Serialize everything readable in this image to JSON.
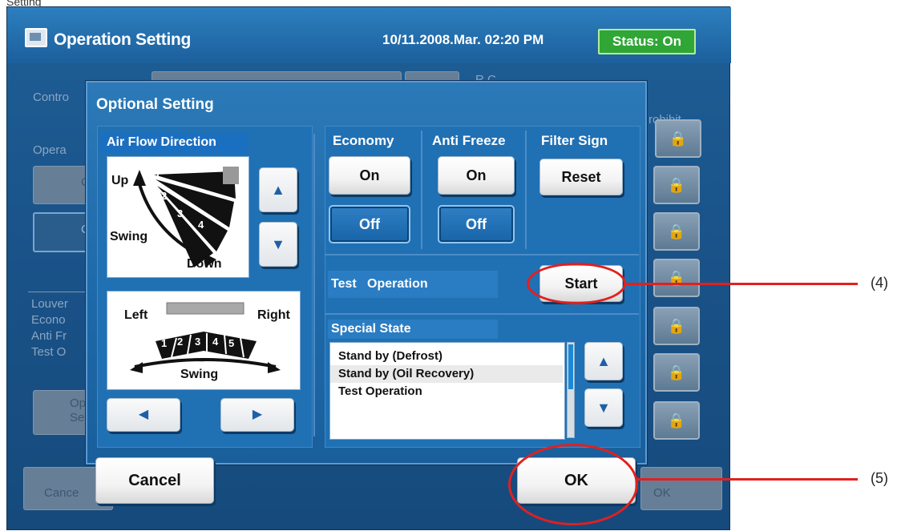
{
  "window": {
    "title": "Operation Setting",
    "datetime": "10/11.2008.Mar. 02:20 PM",
    "status": "Status: On"
  },
  "background": {
    "control_label": "Contro",
    "rc_label": "R.C",
    "operation_label": "Opera",
    "btn_c1": "C",
    "btn_c2": "C",
    "louver_label": "Louver",
    "econo_label": "Econo",
    "antifr_label": "Anti Fr",
    "testo_label": "Test O",
    "optional_btn": "Opt\nSe",
    "cancel_btn": "Cance",
    "ok_btn": "OK",
    "prohibit_label": "rohibit"
  },
  "dialog": {
    "title": "Optional Setting",
    "airflow": {
      "label": "Air Flow Direction",
      "vertical": {
        "up": "Up",
        "swing": "Swing",
        "down": "Down",
        "positions": [
          "1",
          "2",
          "3",
          "4"
        ]
      },
      "horizontal": {
        "left": "Left",
        "right": "Right",
        "swing": "Swing",
        "positions": [
          "1",
          "2",
          "3",
          "4",
          "5"
        ]
      }
    },
    "economy": {
      "label": "Economy",
      "on": "On",
      "off": "Off",
      "selected": "Off"
    },
    "antifreeze": {
      "label": "Anti Freeze",
      "on": "On",
      "off": "Off",
      "selected": "Off"
    },
    "filter_sign": {
      "label": "Filter Sign",
      "reset": "Reset"
    },
    "test_operation": {
      "label": "Test   Operation",
      "start": "Start"
    },
    "special_state": {
      "label": "Special State",
      "items": [
        "Stand by (Defrost)",
        "Stand by (Oil Recovery)",
        "Test Operation"
      ]
    },
    "cancel": "Cancel",
    "ok": "OK"
  },
  "annotations": {
    "a4": "(4)",
    "a5": "(5)"
  },
  "colors": {
    "accent_blue": "#1d68a8",
    "status_green": "#2fa635",
    "annotation_red": "#e1201f"
  }
}
